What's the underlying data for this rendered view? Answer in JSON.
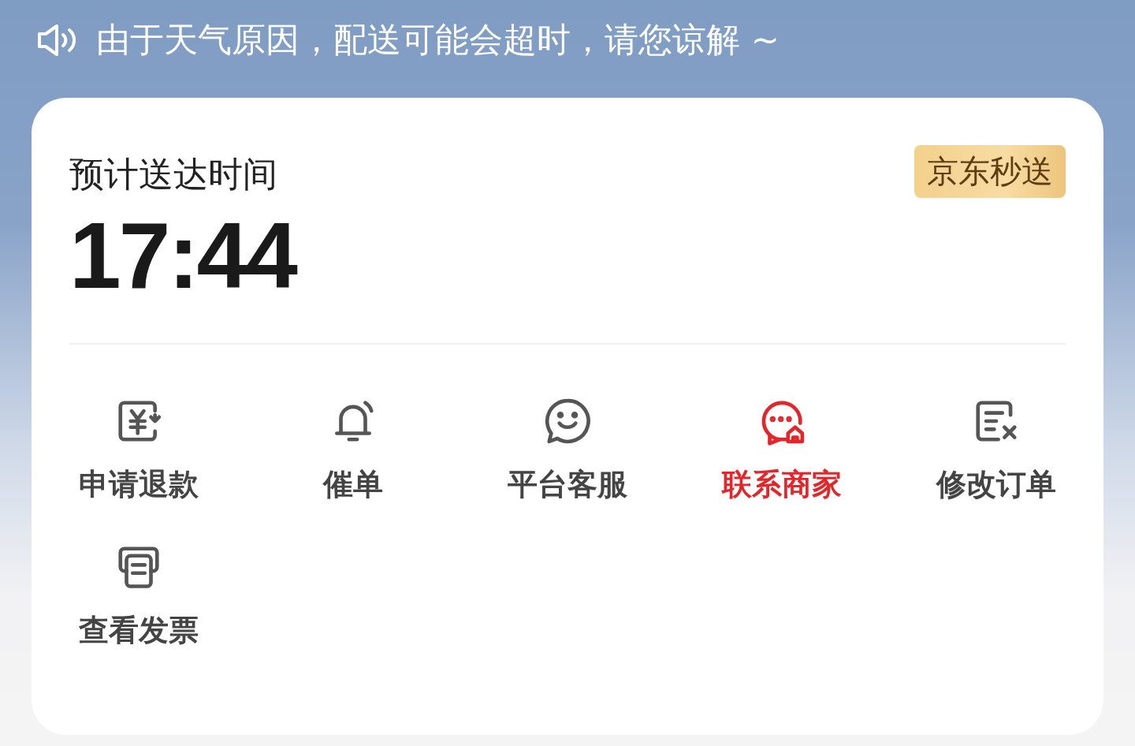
{
  "notice": {
    "text": "由于天气原因，配送可能会超时，请您谅解 ~"
  },
  "delivery": {
    "label": "预计送达时间",
    "time": "17:44",
    "badge": "京东秒送"
  },
  "actions": [
    {
      "kind": "refund",
      "label": "申请退款",
      "highlighted": false
    },
    {
      "kind": "remind",
      "label": "催单",
      "highlighted": false
    },
    {
      "kind": "service",
      "label": "平台客服",
      "highlighted": false
    },
    {
      "kind": "merchant",
      "label": "联系商家",
      "highlighted": true
    },
    {
      "kind": "modify",
      "label": "修改订单",
      "highlighted": false
    },
    {
      "kind": "invoice",
      "label": "查看发票",
      "highlighted": false
    }
  ]
}
